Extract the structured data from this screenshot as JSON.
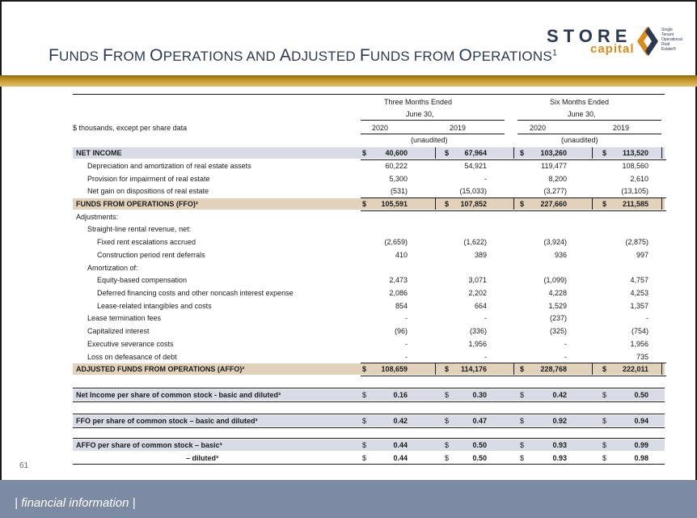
{
  "header": {
    "title_prefix_cap": "F",
    "title_line": "UNDS ",
    "title_f": "F",
    "title_rom": "ROM ",
    "title_o": "O",
    "title_perations": "PERATIONS AND ",
    "title_a": "A",
    "title_djusted": "DJUSTED ",
    "title_f2": "F",
    "title_unds": "UNDS FROM ",
    "title_o2": "O",
    "title_perations2": "PERATIONS",
    "title_sup": "1"
  },
  "logo": {
    "wordmark": "STORE",
    "subword": "capital",
    "tagline": [
      "Single",
      "Tenant",
      "Operational",
      "Real",
      "Estate®"
    ]
  },
  "table": {
    "period_headers": [
      "Three Months Ended",
      "June 30,",
      "Six Months Ended",
      "June 30,"
    ],
    "units_label": "$ thousands, except per share data",
    "years": [
      "2020",
      "2019",
      "2020",
      "2019"
    ],
    "unaudited": "(unaudited)",
    "rows": [
      {
        "label": "NET INCOME",
        "indent": 0,
        "bold": true,
        "hl": "blue",
        "cur": [
          "$",
          "$",
          "$",
          "$"
        ],
        "v": [
          "40,600",
          "67,964",
          "103,260",
          "113,520"
        ]
      },
      {
        "label": "Depreciation and amortization of real estate assets",
        "indent": 1,
        "v": [
          "60,222",
          "54,921",
          "119,477",
          "108,560"
        ]
      },
      {
        "label": "Provision for impairment of real estate",
        "indent": 1,
        "v": [
          "5,300",
          "-",
          "8,200",
          "2,610"
        ]
      },
      {
        "label": "Net gain on dispositions of real estate",
        "indent": 1,
        "v": [
          "(531)",
          "(15,033)",
          "(3,277)",
          "(13,105)"
        ]
      },
      {
        "label": "FUNDS FROM OPERATIONS (FFO)²",
        "indent": 0,
        "bold": true,
        "hl": "tan",
        "cur": [
          "$",
          "$",
          "$",
          "$"
        ],
        "v": [
          "105,591",
          "107,852",
          "227,660",
          "211,585"
        ]
      },
      {
        "label": "Adjustments:",
        "indent": 0,
        "v": [
          "",
          "",
          "",
          ""
        ]
      },
      {
        "label": "Straight-line rental revenue, net:",
        "indent": 1,
        "v": [
          "",
          "",
          "",
          ""
        ]
      },
      {
        "label": "Fixed rent escalations accrued",
        "indent": 2,
        "v": [
          "(2,659)",
          "(1,622)",
          "(3,924)",
          "(2,875)"
        ]
      },
      {
        "label": "Construction period rent deferrals",
        "indent": 2,
        "v": [
          "410",
          "389",
          "936",
          "997"
        ]
      },
      {
        "label": "Amortization of:",
        "indent": 1,
        "v": [
          "",
          "",
          "",
          ""
        ]
      },
      {
        "label": "Equity-based compensation",
        "indent": 2,
        "v": [
          "2,473",
          "3,071",
          "(1,099)",
          "4,757"
        ]
      },
      {
        "label": "Deferred financing costs and other noncash interest expense",
        "indent": 2,
        "v": [
          "2,086",
          "2,202",
          "4,228",
          "4,253"
        ]
      },
      {
        "label": "Lease-related intangibles and costs",
        "indent": 2,
        "v": [
          "854",
          "664",
          "1,529",
          "1,357"
        ]
      },
      {
        "label": "Lease termination fees",
        "indent": 1,
        "v": [
          "-",
          "-",
          "(237)",
          "-"
        ]
      },
      {
        "label": "Capitalized interest",
        "indent": 1,
        "v": [
          "(96)",
          "(336)",
          "(325)",
          "(754)"
        ]
      },
      {
        "label": "Executive severance costs",
        "indent": 1,
        "v": [
          "-",
          "1,956",
          "-",
          "1,956"
        ]
      },
      {
        "label": "Loss on defeasance of debt",
        "indent": 1,
        "v": [
          "-",
          "-",
          "-",
          "735"
        ]
      },
      {
        "label": "ADJUSTED FUNDS FROM OPERATIONS (AFFO)²",
        "indent": 0,
        "bold": true,
        "hl": "tan",
        "cur": [
          "$",
          "$",
          "$",
          "$"
        ],
        "v": [
          "108,659",
          "114,176",
          "228,768",
          "222,011"
        ]
      }
    ],
    "per_share": [
      {
        "label": "Net Income per share of common stock - basic and diluted³",
        "cur": [
          "$",
          "$",
          "$",
          "$"
        ],
        "v": [
          "0.16",
          "0.30",
          "0.42",
          "0.50"
        ]
      },
      {
        "label": "FFO per share of common stock – basic and diluted³",
        "cur": [
          "$",
          "$",
          "$",
          "$"
        ],
        "v": [
          "0.42",
          "0.47",
          "0.92",
          "0.94"
        ]
      },
      {
        "label": "AFFO per share of common stock – basic³",
        "cur": [
          "$",
          "$",
          "$",
          "$"
        ],
        "v": [
          "0.44",
          "0.50",
          "0.93",
          "0.99"
        ]
      },
      {
        "label": "– diluted³",
        "cur": [
          "$",
          "$",
          "$",
          "$"
        ],
        "v": [
          "0.44",
          "0.50",
          "0.93",
          "0.98"
        ]
      }
    ]
  },
  "page_number": "61",
  "footer": "| financial information |"
}
